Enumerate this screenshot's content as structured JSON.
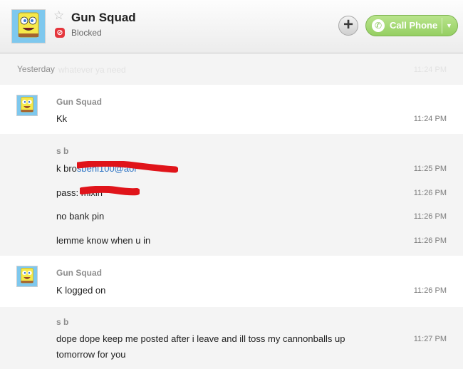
{
  "header": {
    "contact_name": "Gun Squad",
    "status": "Blocked",
    "call_label": "Call Phone"
  },
  "yesterday": {
    "label": "Yesterday",
    "ghost_text": "whatever ya need",
    "ghost_time": "11:24 PM"
  },
  "groups": [
    {
      "sender": "Gun Squad",
      "messages": [
        {
          "text": "Kk",
          "time": "11:24 PM"
        }
      ]
    },
    {
      "sender": "s b",
      "messages": [
        {
          "prefix": "k bro",
          "link": "sbenl100@aol",
          "time": "11:25 PM"
        },
        {
          "prefix": "pass: ",
          "hidden": "mixin",
          "time": "11:26 PM"
        },
        {
          "text": "no bank pin",
          "time": "11:26 PM"
        },
        {
          "text": "lemme know when u in",
          "time": "11:26 PM"
        }
      ]
    },
    {
      "sender": "Gun Squad",
      "messages": [
        {
          "text": "K logged on",
          "time": "11:26 PM"
        }
      ]
    },
    {
      "sender": "s b",
      "messages": [
        {
          "text": "dope dope keep me posted after i leave and ill toss my cannonballs up tomorrow for you",
          "time": "11:27 PM"
        }
      ]
    }
  ],
  "colors": {
    "accent_green": "#95cf62",
    "blocked_red": "#e5363d",
    "link_blue": "#2d74c4",
    "redaction_red": "#e0141a"
  },
  "icons": {
    "star": "star-icon",
    "blocked": "blocked-icon",
    "add": "plus-icon",
    "call": "phone-icon",
    "dropdown": "chevron-down-icon"
  }
}
